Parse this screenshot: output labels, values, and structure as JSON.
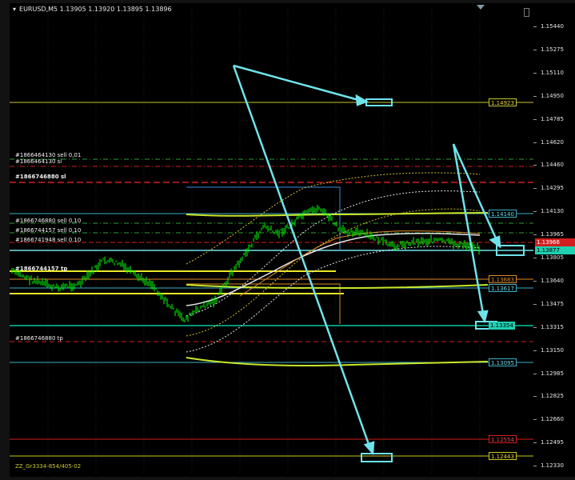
{
  "window": {
    "title": "EURUSD,M5  1.13905 1.13920 1.13895 1.13896"
  },
  "price_axis": {
    "ticks": [
      "1.15440",
      "1.15275",
      "1.15110",
      "1.14950",
      "1.14785",
      "1.14620",
      "1.14460",
      "1.14295",
      "1.14130",
      "1.13965",
      "1.13805",
      "1.13640",
      "1.13475",
      "1.13315",
      "1.13150",
      "1.12985",
      "1.12825",
      "1.12660",
      "1.12495",
      "1.12330"
    ]
  },
  "order_labels": {
    "sell_001": "#1866464130 sell 0,01",
    "sl_001": "#1866464130 sl",
    "sl_group": "#1866746880 sl",
    "sell_a": "#1866746880 sell 0,10",
    "sell_b": "#1866744157 sell 0,10",
    "sell_c": "#1866741948 sell 0,10",
    "tp_group": "#1866744157 tp",
    "tp_880": "#1866746880 tp"
  },
  "price_tags": {
    "p14923": "1.14923",
    "p14140": "1.14140",
    "p13966": "1.13966",
    "p13877": "1.13877",
    "p13683": "1.13683",
    "p13617": "1.13617",
    "p13354": "1.13354",
    "p13095": "1.13095",
    "p12554": "1.12554",
    "p12443": "1.12443"
  },
  "indicator_label": "ZZ_Gr3334-854/405-02",
  "colors": {
    "candle": "#00ff00",
    "level_yellow": "#c8c82a",
    "level_cyan": "#3bb0c8",
    "level_red": "#d21e1e",
    "annotation": "#6fe3ea",
    "orange": "#e08a2a"
  },
  "icons": [
    "dropdown-triangle-icon",
    "window-maximize-icon"
  ]
}
